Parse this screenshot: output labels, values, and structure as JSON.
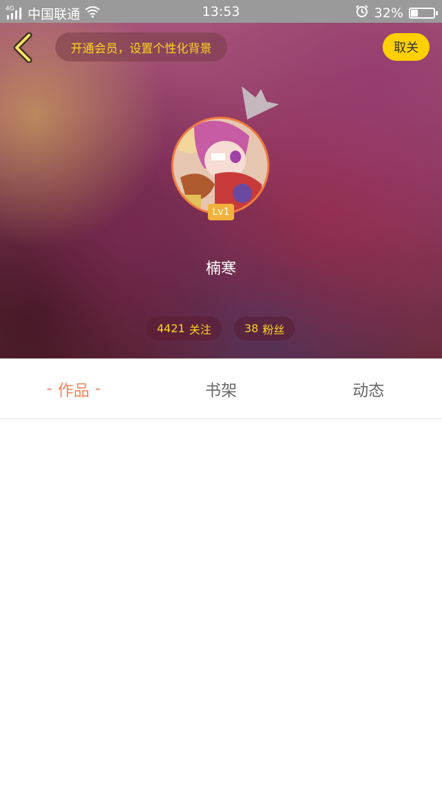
{
  "status_bar": {
    "network_type": "4G",
    "carrier": "中国联通",
    "time": "13:53",
    "battery_percent": "32%",
    "battery_level": 0.32
  },
  "header": {
    "vip_banner": "开通会员，设置个性化背景",
    "unfollow_label": "取关",
    "level_badge": "Lv1",
    "username": "楠寒",
    "following": {
      "count": "4421",
      "label": "关注"
    },
    "fans": {
      "count": "38",
      "label": "粉丝"
    }
  },
  "tabs": [
    {
      "label": "作品",
      "active": true
    },
    {
      "label": "书架",
      "active": false
    },
    {
      "label": "动态",
      "active": false
    }
  ],
  "colors": {
    "accent_yellow": "#ffd000",
    "banner_text": "#ffd21f",
    "active_tab": "#f0875a",
    "avatar_ring": "#f07a3e"
  },
  "icons": [
    "back-arrow-icon",
    "signal-icon",
    "wifi-icon",
    "alarm-icon",
    "battery-icon",
    "crown-icon"
  ]
}
